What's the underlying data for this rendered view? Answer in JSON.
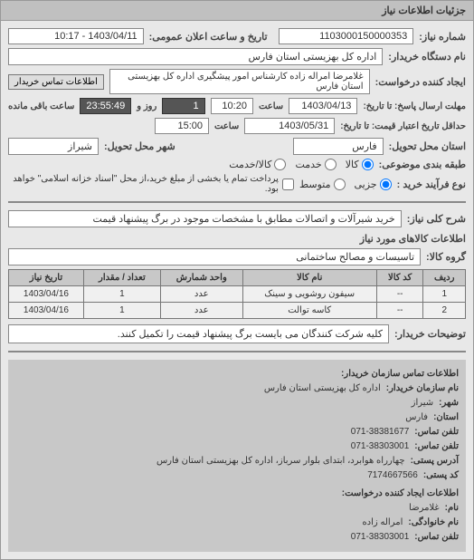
{
  "header": "جزئیات اطلاعات نیاز",
  "fields": {
    "req_no_lbl": "شماره نیاز:",
    "req_no": "1103000150000353",
    "announce_lbl": "تاریخ و ساعت اعلان عمومی:",
    "announce": "1403/04/11 - 10:17",
    "buyer_org_lbl": "نام دستگاه خریدار:",
    "buyer_org": "اداره کل بهزیستی استان فارس",
    "requester_lbl": "ایجاد کننده درخواست:",
    "requester": "غلامرضا امراله زاده کارشناس امور پیشگیری اداره کل بهزیستی استان فارس",
    "buyer_contact_btn": "اطلاعات تماس خریدار",
    "deadline_from_lbl": "مهلت ارسال پاسخ: تا تاریخ:",
    "deadline_date": "1403/04/13",
    "time_lbl": "ساعت",
    "deadline_time": "10:20",
    "days_lbl": "روز و",
    "days_val": "1",
    "remain_lbl": "ساعت باقی مانده",
    "remain_val": "23:55:49",
    "valid_lbl": "حداقل تاریخ اعتبار قیمت: تا تاریخ:",
    "valid_date": "1403/05/31",
    "valid_time": "15:00",
    "province_lbl": "استان محل تحویل:",
    "province": "فارس",
    "city_lbl": "شهر محل تحویل:",
    "city": "شیراز",
    "pkg_lbl": "طبقه بندی موضوعی:",
    "pkg_goods": "کالا",
    "pkg_service": "خدمت",
    "pkg_both": "کالا/خدمت",
    "buy_type_lbl": "نوع فرآیند خرید :",
    "bt_partial": "جزیی",
    "bt_medium": "متوسط",
    "bt_note": "پرداخت تمام یا بخشی از مبلغ خرید،از محل \"اسناد خزانه اسلامی\" خواهد بود.",
    "need_title_lbl": "شرح کلی نیاز:",
    "need_title": "خرید شیرآلات و اتصالات مطابق با مشخصات موجود در برگ پیشنهاد قیمت",
    "goods_title": "اطلاعات کالاهای مورد نیاز",
    "group_lbl": "گروه کالا:",
    "group": "تاسیسات و مصالح ساختمانی",
    "desc_lbl": "توضیحات خریدار:",
    "desc": "کلیه شرکت کنندگان می بایست برگ پیشنهاد قیمت را تکمیل کنند."
  },
  "table": {
    "headers": [
      "ردیف",
      "کد کالا",
      "نام کالا",
      "واحد شمارش",
      "تعداد / مقدار",
      "تاریخ نیاز"
    ],
    "rows": [
      [
        "1",
        "--",
        "سیفون روشویی و سینک",
        "عدد",
        "1",
        "1403/04/16"
      ],
      [
        "2",
        "--",
        "کاسه توالت",
        "عدد",
        "1",
        "1403/04/16"
      ]
    ]
  },
  "contact": {
    "title": "اطلاعات تماس سازمان خریدار:",
    "org_lbl": "نام سازمان خریدار:",
    "org": "اداره کل بهزیستی استان فارس",
    "city_lbl": "شهر:",
    "city": "شیراز",
    "province_lbl": "استان:",
    "province": "فارس",
    "phone_lbl": "تلفن تماس:",
    "phone": "071-38381677",
    "fax_lbl": "تلفن تماس:",
    "fax": "071-38303001",
    "addr_lbl": "آدرس پستی:",
    "addr": "چهارراه هوابرد، ابتدای بلوار سرباز، اداره کل بهزیستی استان فارس",
    "postal_lbl": "کد پستی:",
    "postal": "7174667566",
    "creator_title": "اطلاعات ایجاد کننده درخواست:",
    "fname_lbl": "نام:",
    "fname": "غلامرضا",
    "lname_lbl": "نام خانوادگی:",
    "lname": "امراله زاده",
    "cphone_lbl": "تلفن تماس:",
    "cphone": "071-38303001"
  }
}
